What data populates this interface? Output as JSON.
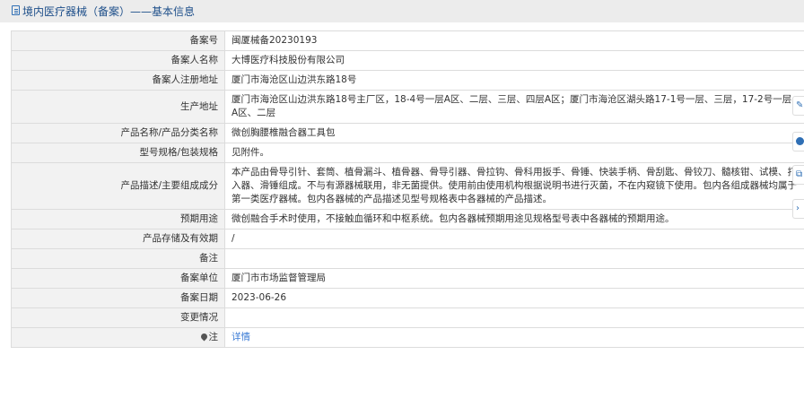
{
  "header": {
    "title": "境内医疗器械（备案）——基本信息",
    "icon": "document-icon"
  },
  "rows": [
    {
      "label": "备案号",
      "value": "闽厦械备20230193"
    },
    {
      "label": "备案人名称",
      "value": "大博医疗科技股份有限公司"
    },
    {
      "label": "备案人注册地址",
      "value": "厦门市海沧区山边洪东路18号"
    },
    {
      "label": "生产地址",
      "value": "厦门市海沧区山边洪东路18号主厂区，18-4号一层A区、二层、三层、四层A区；厦门市海沧区湖头路17-1号一层、三层，17-2号一层A区、二层"
    },
    {
      "label": "产品名称/产品分类名称",
      "value": "微创胸腰椎融合器工具包"
    },
    {
      "label": "型号规格/包装规格",
      "value": "见附件。"
    },
    {
      "label": "产品描述/主要组成成分",
      "value": "本产品由骨导引针、套筒、植骨漏斗、植骨器、骨导引器、骨拉钩、骨科用扳手、骨锤、快装手柄、骨刮匙、骨铰刀、髓核钳、试模、打入器、滑锤组成。不与有源器械联用，非无菌提供。使用前由使用机构根据说明书进行灭菌，不在内窥镜下使用。包内各组成器械均属于第一类医疗器械。包内各器械的产品描述见型号规格表中各器械的产品描述。"
    },
    {
      "label": "预期用途",
      "value": "微创融合手术时使用，不接触血循环和中枢系统。包内各器械预期用途见规格型号表中各器械的预期用途。"
    },
    {
      "label": "产品存储及有效期",
      "value": "/"
    },
    {
      "label": "备注",
      "value": ""
    },
    {
      "label": "备案单位",
      "value": "厦门市市场监督管理局"
    },
    {
      "label": "备案日期",
      "value": "2023-06-26"
    },
    {
      "label": "变更情况",
      "value": ""
    }
  ],
  "note_row": {
    "label": "注",
    "icon": "pin-icon",
    "link_text": "详情"
  },
  "colors": {
    "label_bg": "#f2f2f2",
    "border": "#dcdcdc",
    "link": "#3a7bd5",
    "title": "#1e4f8a"
  }
}
